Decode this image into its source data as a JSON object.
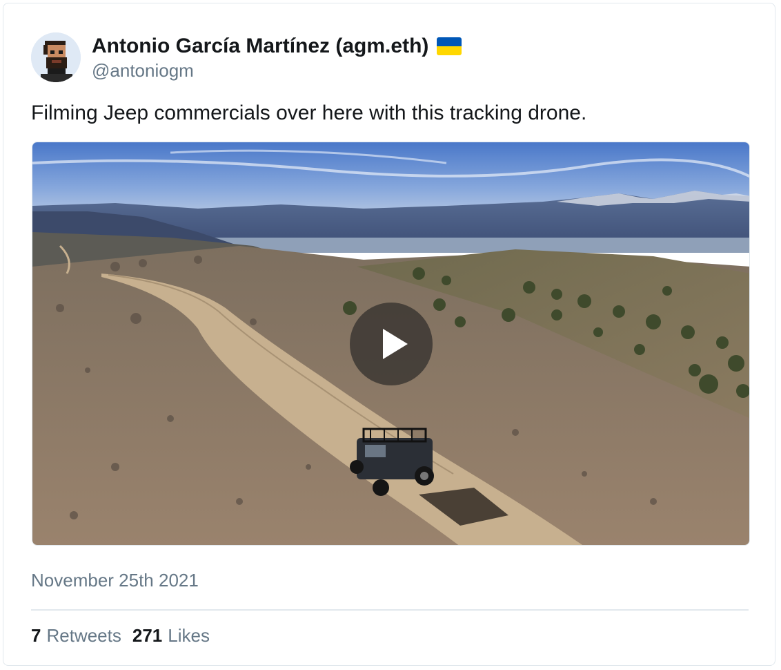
{
  "tweet": {
    "author": {
      "display_name": "Antonio García Martínez (agm.eth)",
      "handle": "@antoniogm",
      "avatar_icon": "pixel-art-avatar",
      "flag_icon": "ukraine-flag-icon"
    },
    "text": "Filming Jeep commercials over here with this tracking drone.",
    "media": {
      "type": "video",
      "play_icon": "play-icon"
    },
    "date": "November 25th 2021",
    "stats": {
      "retweets_count": "7",
      "retweets_label": "Retweets",
      "likes_count": "271",
      "likes_label": "Likes"
    }
  },
  "colors": {
    "text_primary": "#14171a",
    "text_secondary": "#657786",
    "border": "#e1e8ed",
    "flag_blue": "#0057b7",
    "flag_yellow": "#ffd700"
  }
}
